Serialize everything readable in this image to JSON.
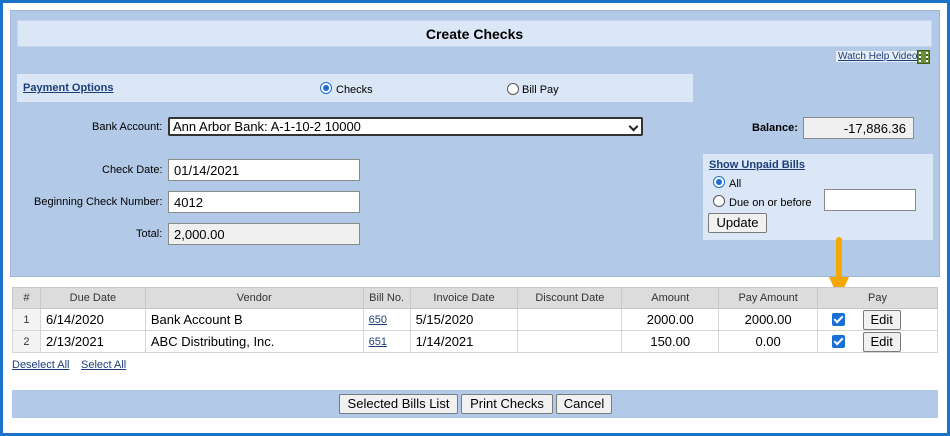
{
  "title": "Create Checks",
  "help_link": "Watch Help Video!",
  "icons": {
    "help": "film-icon",
    "arrow": "down-arrow-icon"
  },
  "payment_options": {
    "label": "Payment Options",
    "checks_label": "Checks",
    "billpay_label": "Bill Pay",
    "selected": "Checks"
  },
  "bank_account": {
    "label": "Bank Account:",
    "value": "Ann Arbor Bank: A-1-10-2 10000"
  },
  "balance": {
    "label": "Balance:",
    "value": "-17,886.36"
  },
  "check_date": {
    "label": "Check Date:",
    "value": "01/14/2021"
  },
  "beginning_check": {
    "label": "Beginning Check Number:",
    "value": "4012"
  },
  "total": {
    "label": "Total:",
    "value": "2,000.00"
  },
  "unpaid": {
    "title": "Show Unpaid Bills",
    "all_label": "All",
    "due_label": "Due on or before",
    "due_value": "",
    "update_label": "Update",
    "selected": "All"
  },
  "table": {
    "headers": [
      "#",
      "Due Date",
      "Vendor",
      "Bill No.",
      "Invoice Date",
      "Discount Date",
      "Amount",
      "Pay Amount",
      "Pay"
    ],
    "rows": [
      {
        "num": "1",
        "due": "6/14/2020",
        "vendor": "Bank Account B",
        "bill": "650",
        "invoice": "5/15/2020",
        "discount": "",
        "amount": "2000.00",
        "pay_amount": "2000.00",
        "checked": true,
        "edit": "Edit"
      },
      {
        "num": "2",
        "due": "2/13/2021",
        "vendor": "ABC Distributing, Inc.",
        "bill": "651",
        "invoice": "1/14/2021",
        "discount": "",
        "amount": "150.00",
        "pay_amount": "0.00",
        "checked": true,
        "edit": "Edit"
      }
    ]
  },
  "links": {
    "deselect_all": "Deselect All",
    "select_all": "Select All"
  },
  "buttons": {
    "selected_bills": "Selected Bills List",
    "print_checks": "Print Checks",
    "cancel": "Cancel"
  },
  "colors": {
    "accent": "#1a73c9",
    "panel": "#b3c9e8",
    "arrow": "#f5a800"
  }
}
